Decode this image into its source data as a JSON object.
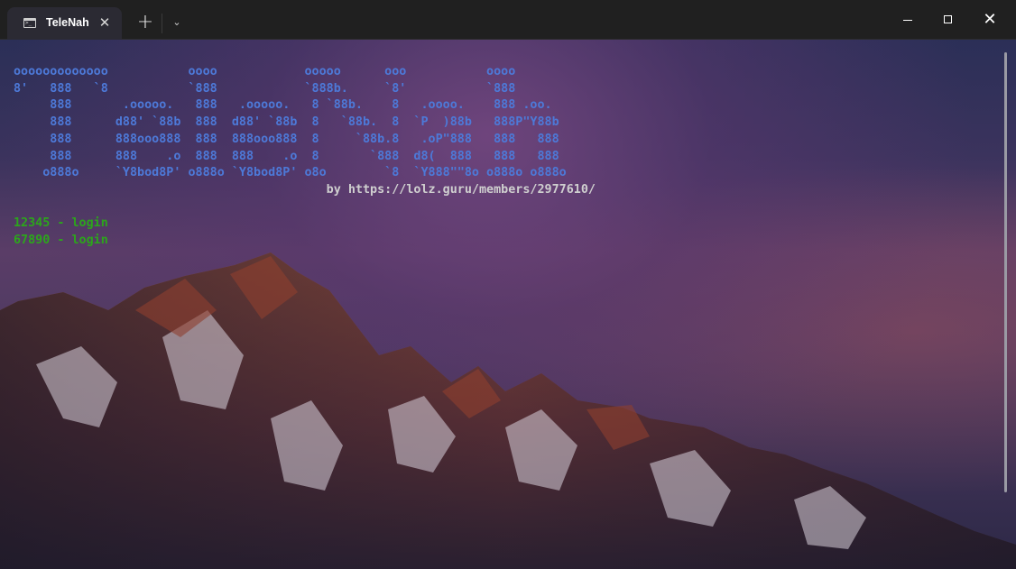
{
  "window": {
    "tab_title": "TeleNah",
    "tab_close": "✕",
    "new_tab": "+",
    "dropdown": "⌄",
    "close": "✕"
  },
  "terminal": {
    "ascii_lines": [
      "ooooooooooooo           oooo            ooooo      ooo           oooo",
      "8'   888   `8           `888            `888b.     `8'           `888",
      "     888       .ooooo.   888   .ooooo.   8 `88b.    8   .oooo.    888 .oo.",
      "     888      d88' `88b  888  d88' `88b  8   `88b.  8  `P  )88b   888P\"Y88b",
      "     888      888ooo888  888  888ooo888  8     `88b.8   .oP\"888   888   888",
      "     888      888    .o  888  888    .o  8       `888  d8(  888   888   888",
      "    o888o     `Y8bod8P' o888o `Y8bod8P' o8o        `8  `Y888\"\"8o o888o o888o"
    ],
    "credit": "                                           by https://lolz.guru/members/2977610/",
    "logins": [
      "12345 - login",
      "67890 - login"
    ]
  },
  "colors": {
    "ascii": "#4d79d8",
    "credit": "#cfcfcf",
    "login": "#2ca61b"
  }
}
